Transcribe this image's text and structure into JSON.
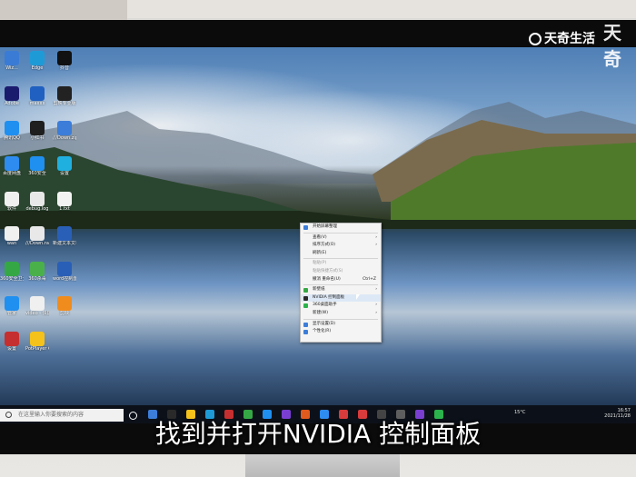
{
  "watermark": {
    "brand": "天奇生活",
    "corner": "天奇"
  },
  "subtitle": "找到并打开NVIDIA 控制面板",
  "desktop_icons": [
    {
      "label": "Wiz...",
      "color": "#3a7bd5"
    },
    {
      "label": "Adobe",
      "color": "#1b1b6e"
    },
    {
      "label": "腾讯QQ",
      "color": "#1f8ff0"
    },
    {
      "label": "百度网盘",
      "color": "#2e8bf0"
    },
    {
      "label": "软件",
      "color": "#f0f0f0"
    },
    {
      "label": "wan",
      "color": "#f0f0f0"
    },
    {
      "label": "360安全卫士",
      "color": "#35a845"
    },
    {
      "label": "管家",
      "color": "#1f8ff0"
    },
    {
      "label": "设置",
      "color": "#c62f2f"
    },
    {
      "label": "Edge",
      "color": "#1e9bd7"
    },
    {
      "label": "maxxx",
      "color": "#2060c0"
    },
    {
      "label": "小红书",
      "color": "#1f1f1f"
    },
    {
      "label": "360安全",
      "color": "#1f8ff0"
    },
    {
      "label": "debug.log",
      "color": "#e8e8e8"
    },
    {
      "label": "///Down.rar",
      "color": "#e8e8e8"
    },
    {
      "label": "360杀毒",
      "color": "#4ab14a"
    },
    {
      "label": "video - 快捷方式",
      "color": "#f0f0f0"
    },
    {
      "label": "PotPlayer 64 bit",
      "color": "#f4c21a"
    },
    {
      "label": "抖音",
      "color": "#111111"
    },
    {
      "label": "剪映专业版",
      "color": "#222222"
    },
    {
      "label": "///Down.zip",
      "color": "#3c7dd9"
    },
    {
      "label": "设置",
      "color": "#20b0e0"
    },
    {
      "label": "1.txt",
      "color": "#f3f3f3"
    },
    {
      "label": "新建文本文档.docx",
      "color": "#2a5fb7"
    },
    {
      "label": "word控制面板.docx",
      "color": "#2a5fb7"
    },
    {
      "label": "剪映",
      "color": "#f08c1e"
    }
  ],
  "context_menu": {
    "items": [
      {
        "label": "开始屏幕整理",
        "disabled": false,
        "shortcut": "",
        "submenu": false,
        "icon_color": "#3c7dd9"
      },
      {
        "label": "查看(V)",
        "disabled": false,
        "shortcut": "",
        "submenu": true,
        "icon_color": ""
      },
      {
        "label": "排序方式(O)",
        "disabled": false,
        "shortcut": "",
        "submenu": true,
        "icon_color": ""
      },
      {
        "label": "刷新(E)",
        "disabled": false,
        "shortcut": "",
        "submenu": false,
        "icon_color": ""
      },
      {
        "label": "粘贴(P)",
        "disabled": true,
        "shortcut": "",
        "submenu": false,
        "icon_color": ""
      },
      {
        "label": "粘贴快捷方式(S)",
        "disabled": true,
        "shortcut": "",
        "submenu": false,
        "icon_color": ""
      },
      {
        "label": "撤消 重命名(U)",
        "disabled": false,
        "shortcut": "Ctrl+Z",
        "submenu": false,
        "icon_color": ""
      },
      {
        "label": "新壁纸",
        "disabled": false,
        "shortcut": "",
        "submenu": true,
        "icon_color": "#35a845"
      },
      {
        "label": "NVIDIA 控制面板",
        "disabled": false,
        "shortcut": "",
        "submenu": false,
        "icon_color": "#2a2a2a",
        "highlight": true
      },
      {
        "label": "360桌面助手",
        "disabled": false,
        "shortcut": "",
        "submenu": true,
        "icon_color": "#2bb24c"
      },
      {
        "label": "新建(W)",
        "disabled": false,
        "shortcut": "",
        "submenu": true,
        "icon_color": ""
      },
      {
        "label": "显示设置(D)",
        "disabled": false,
        "shortcut": "",
        "submenu": false,
        "icon_color": "#3c7dd9"
      },
      {
        "label": "个性化(R)",
        "disabled": false,
        "shortcut": "",
        "submenu": false,
        "icon_color": "#3c7dd9"
      }
    ]
  },
  "taskbar": {
    "search_placeholder": "在这里输入你要搜索的内容",
    "weather": "15°C",
    "time": "16:57",
    "date": "2021/11/28",
    "app_icon_colors": [
      "#ffffff",
      "#3c7dd9",
      "#2a2a2a",
      "#f4c21a",
      "#1e9bd7",
      "#c62f2f",
      "#35a845",
      "#1f8ff0",
      "#7a3fd1",
      "#e05a1e",
      "#2e8bf0",
      "#d83b3b",
      "#d83b3b",
      "#444444",
      "#5e5e5e",
      "#7a3fd1",
      "#2bb24c"
    ]
  }
}
